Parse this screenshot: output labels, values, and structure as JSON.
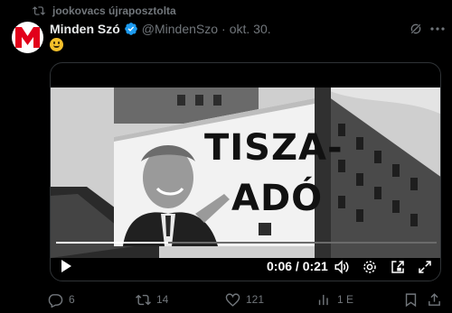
{
  "repost": {
    "text": "jookovacs újraposztolta",
    "icon": "repost-icon"
  },
  "author": {
    "name": "Minden Szó",
    "handle": "@MindenSzo",
    "separator": "·",
    "date": "okt. 30.",
    "avatar_letter": "M",
    "brand_color": "#e2001a",
    "verified_color": "#1d9bf0"
  },
  "tweet": {
    "text_emoji": "smiling-face-emoji"
  },
  "video": {
    "billboard_line1": "TISZA-",
    "billboard_line2": "ADÓ",
    "elapsed": "0:06",
    "duration": "0:21",
    "time_separator": "/",
    "progress_fraction": 0.294
  },
  "actions": {
    "replies": "6",
    "reposts": "14",
    "likes": "121",
    "views": "1 E"
  },
  "colors": {
    "repost_active": "#00ba7c",
    "muted": "#71767b"
  }
}
